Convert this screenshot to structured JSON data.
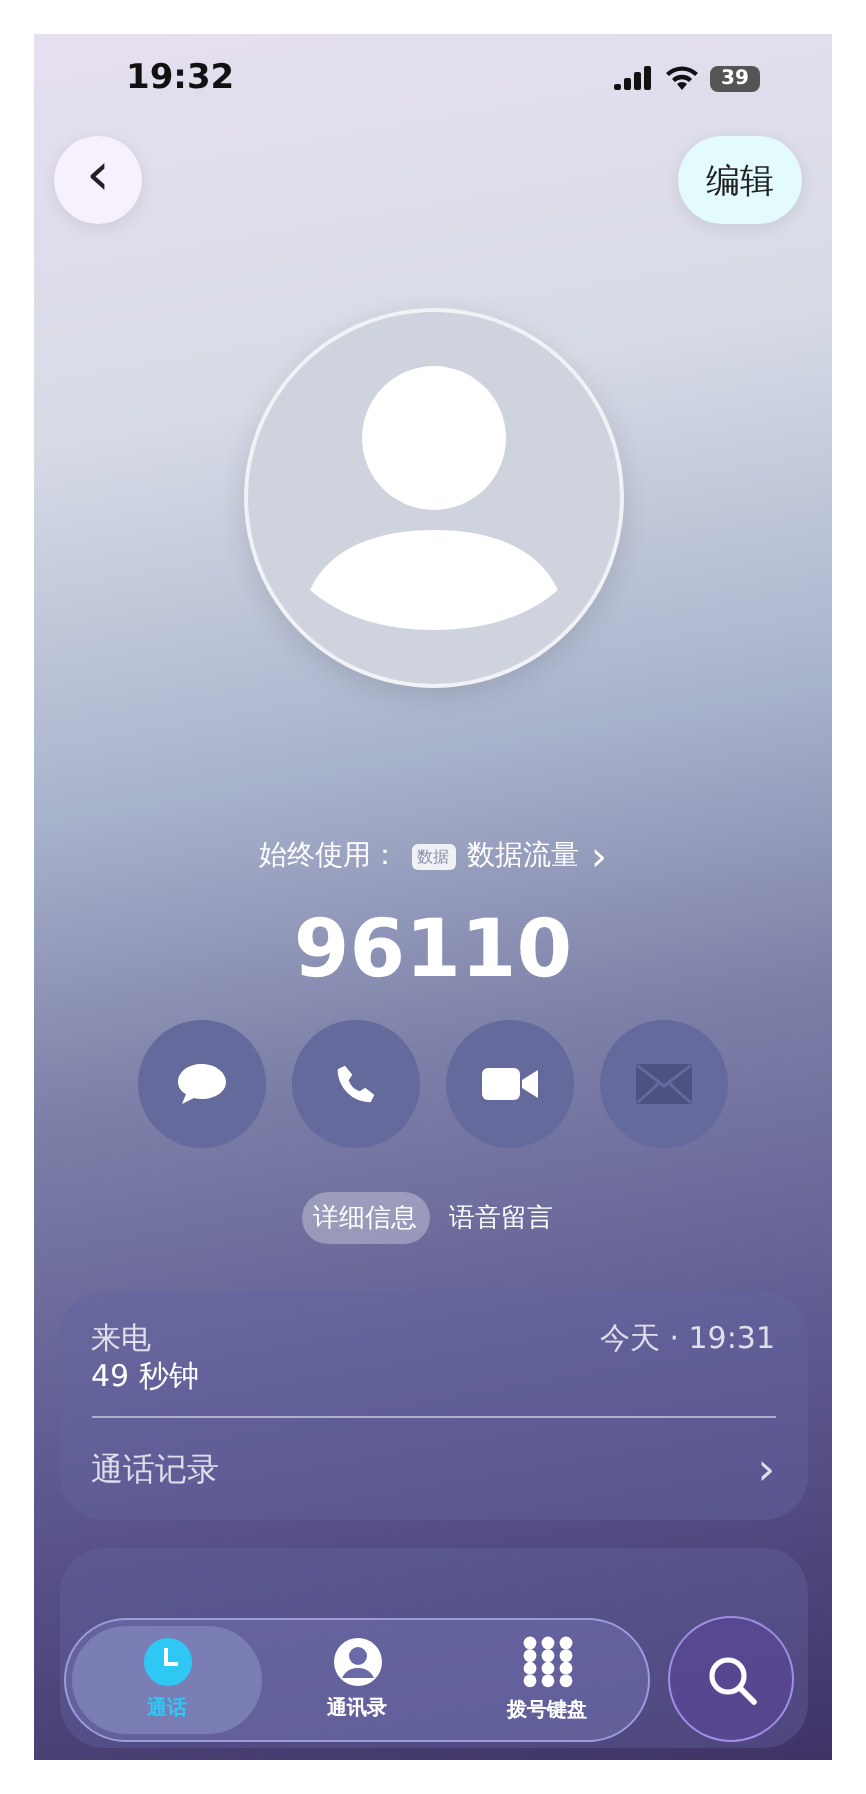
{
  "status_bar": {
    "time": "19:32",
    "battery": "39"
  },
  "nav": {
    "back": "‹",
    "edit": "编辑"
  },
  "sim": {
    "label": "始终使用：",
    "badge": "数据",
    "line": "数据流量",
    "chevron": "›"
  },
  "number": "96110",
  "actions": [
    {
      "kind": "message",
      "disabled": false
    },
    {
      "kind": "phone",
      "disabled": false
    },
    {
      "kind": "video",
      "disabled": false
    },
    {
      "kind": "mail",
      "disabled": true
    }
  ],
  "segments": [
    {
      "label": "详细信息",
      "selected": true
    },
    {
      "label": "语音留言",
      "selected": false
    }
  ],
  "call_card": {
    "type": "来电",
    "duration": "49 秒钟",
    "time": "今天 · 19:31",
    "history": "通话记录",
    "chevron": "›"
  },
  "tab_bar": [
    {
      "kind": "calls",
      "label": "通话",
      "selected": true
    },
    {
      "kind": "contacts",
      "label": "通讯录",
      "selected": false
    },
    {
      "kind": "keypad",
      "label": "拨号键盘",
      "selected": false
    }
  ]
}
